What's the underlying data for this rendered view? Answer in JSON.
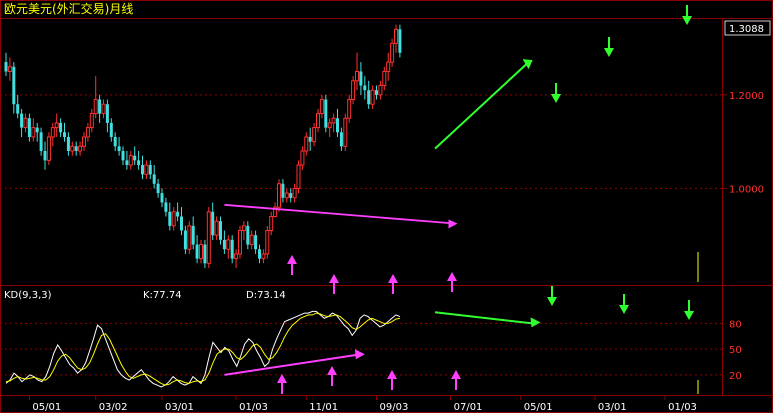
{
  "chart_data": [
    {
      "type": "candlestick",
      "title": "欧元美元(外汇交易)月线",
      "last_price_label": "1.3088",
      "y_ticks": [
        "1.2000",
        "1.0000"
      ],
      "y_tick_values": [
        1.2,
        1.0
      ],
      "ylim": [
        0.8,
        1.36
      ],
      "x_tick_labels": [
        "05/01",
        "03/02",
        "03/01",
        "01/03",
        "11/01",
        "09/03",
        "07/01",
        "05/01",
        "03/01",
        "01/03"
      ],
      "x_tick_index": [
        6,
        23,
        40,
        59,
        77,
        95,
        114,
        132,
        151,
        169
      ],
      "up_color": "#ff3030",
      "down_color": "#40e0e0",
      "candles": [
        [
          1.27,
          1.29,
          1.24,
          1.25
        ],
        [
          1.25,
          1.28,
          1.23,
          1.26
        ],
        [
          1.26,
          1.27,
          1.16,
          1.18
        ],
        [
          1.18,
          1.2,
          1.15,
          1.16
        ],
        [
          1.16,
          1.17,
          1.11,
          1.13
        ],
        [
          1.13,
          1.16,
          1.12,
          1.15
        ],
        [
          1.15,
          1.16,
          1.1,
          1.11
        ],
        [
          1.11,
          1.15,
          1.1,
          1.13
        ],
        [
          1.13,
          1.14,
          1.1,
          1.12
        ],
        [
          1.12,
          1.13,
          1.07,
          1.08
        ],
        [
          1.08,
          1.1,
          1.04,
          1.06
        ],
        [
          1.06,
          1.12,
          1.05,
          1.11
        ],
        [
          1.11,
          1.14,
          1.09,
          1.13
        ],
        [
          1.13,
          1.16,
          1.11,
          1.14
        ],
        [
          1.14,
          1.15,
          1.11,
          1.12
        ],
        [
          1.12,
          1.14,
          1.1,
          1.11
        ],
        [
          1.11,
          1.12,
          1.07,
          1.08
        ],
        [
          1.08,
          1.1,
          1.07,
          1.09
        ],
        [
          1.09,
          1.1,
          1.07,
          1.08
        ],
        [
          1.08,
          1.1,
          1.07,
          1.09
        ],
        [
          1.09,
          1.12,
          1.08,
          1.11
        ],
        [
          1.11,
          1.14,
          1.1,
          1.13
        ],
        [
          1.13,
          1.17,
          1.12,
          1.16
        ],
        [
          1.16,
          1.24,
          1.15,
          1.19
        ],
        [
          1.19,
          1.2,
          1.14,
          1.16
        ],
        [
          1.16,
          1.19,
          1.15,
          1.18
        ],
        [
          1.18,
          1.19,
          1.12,
          1.14
        ],
        [
          1.14,
          1.15,
          1.1,
          1.11
        ],
        [
          1.11,
          1.12,
          1.08,
          1.09
        ],
        [
          1.09,
          1.11,
          1.07,
          1.08
        ],
        [
          1.08,
          1.09,
          1.05,
          1.06
        ],
        [
          1.06,
          1.08,
          1.04,
          1.05
        ],
        [
          1.05,
          1.08,
          1.04,
          1.07
        ],
        [
          1.07,
          1.09,
          1.05,
          1.06
        ],
        [
          1.06,
          1.08,
          1.04,
          1.05
        ],
        [
          1.05,
          1.07,
          1.02,
          1.03
        ],
        [
          1.03,
          1.06,
          1.02,
          1.05
        ],
        [
          1.05,
          1.06,
          1.02,
          1.03
        ],
        [
          1.03,
          1.05,
          1.0,
          1.01
        ],
        [
          1.01,
          1.02,
          0.98,
          0.99
        ],
        [
          0.99,
          1.0,
          0.96,
          0.97
        ],
        [
          0.97,
          0.98,
          0.94,
          0.95
        ],
        [
          0.95,
          0.97,
          0.91,
          0.92
        ],
        [
          0.92,
          0.96,
          0.91,
          0.95
        ],
        [
          0.95,
          0.97,
          0.93,
          0.94
        ],
        [
          0.94,
          0.96,
          0.9,
          0.91
        ],
        [
          0.91,
          0.92,
          0.86,
          0.87
        ],
        [
          0.87,
          0.93,
          0.86,
          0.92
        ],
        [
          0.92,
          0.94,
          0.87,
          0.88
        ],
        [
          0.88,
          0.9,
          0.84,
          0.85
        ],
        [
          0.85,
          0.89,
          0.84,
          0.88
        ],
        [
          0.88,
          0.89,
          0.83,
          0.84
        ],
        [
          0.84,
          0.96,
          0.83,
          0.95
        ],
        [
          0.95,
          0.97,
          0.89,
          0.9
        ],
        [
          0.9,
          0.94,
          0.89,
          0.93
        ],
        [
          0.93,
          0.94,
          0.88,
          0.89
        ],
        [
          0.89,
          0.91,
          0.86,
          0.87
        ],
        [
          0.87,
          0.9,
          0.85,
          0.89
        ],
        [
          0.89,
          0.9,
          0.84,
          0.85
        ],
        [
          0.85,
          0.87,
          0.83,
          0.86
        ],
        [
          0.86,
          0.92,
          0.85,
          0.91
        ],
        [
          0.91,
          0.93,
          0.89,
          0.92
        ],
        [
          0.92,
          0.93,
          0.87,
          0.88
        ],
        [
          0.88,
          0.91,
          0.87,
          0.9
        ],
        [
          0.9,
          0.91,
          0.86,
          0.87
        ],
        [
          0.87,
          0.88,
          0.84,
          0.85
        ],
        [
          0.85,
          0.87,
          0.84,
          0.86
        ],
        [
          0.86,
          0.92,
          0.85,
          0.91
        ],
        [
          0.91,
          0.95,
          0.9,
          0.94
        ],
        [
          0.94,
          0.96,
          0.97,
          0.96
        ],
        [
          0.96,
          1.02,
          0.95,
          1.01
        ],
        [
          1.01,
          1.02,
          0.97,
          0.98
        ],
        [
          0.98,
          1.0,
          0.97,
          0.99
        ],
        [
          0.99,
          1.0,
          0.97,
          0.98
        ],
        [
          0.98,
          1.01,
          0.97,
          1.0
        ],
        [
          1.0,
          1.06,
          0.99,
          1.05
        ],
        [
          1.05,
          1.09,
          1.04,
          1.08
        ],
        [
          1.08,
          1.12,
          1.07,
          1.11
        ],
        [
          1.11,
          1.13,
          1.08,
          1.1
        ],
        [
          1.1,
          1.14,
          1.09,
          1.13
        ],
        [
          1.13,
          1.17,
          1.12,
          1.16
        ],
        [
          1.16,
          1.2,
          1.15,
          1.19
        ],
        [
          1.19,
          1.2,
          1.12,
          1.13
        ],
        [
          1.13,
          1.15,
          1.11,
          1.14
        ],
        [
          1.14,
          1.16,
          1.12,
          1.15
        ],
        [
          1.15,
          1.17,
          1.11,
          1.12
        ],
        [
          1.12,
          1.13,
          1.08,
          1.09
        ],
        [
          1.09,
          1.16,
          1.08,
          1.15
        ],
        [
          1.15,
          1.2,
          1.14,
          1.19
        ],
        [
          1.19,
          1.24,
          1.18,
          1.23
        ],
        [
          1.23,
          1.29,
          1.21,
          1.25
        ],
        [
          1.25,
          1.27,
          1.2,
          1.22
        ],
        [
          1.22,
          1.24,
          1.19,
          1.21
        ],
        [
          1.21,
          1.23,
          1.17,
          1.18
        ],
        [
          1.18,
          1.22,
          1.17,
          1.21
        ],
        [
          1.21,
          1.22,
          1.19,
          1.2
        ],
        [
          1.2,
          1.23,
          1.19,
          1.22
        ],
        [
          1.22,
          1.26,
          1.21,
          1.25
        ],
        [
          1.25,
          1.29,
          1.23,
          1.27
        ],
        [
          1.27,
          1.32,
          1.26,
          1.31
        ],
        [
          1.31,
          1.35,
          1.29,
          1.34
        ],
        [
          1.34,
          1.35,
          1.28,
          1.29
        ]
      ],
      "annotations": {
        "magenta_trendline": [
          [
            56,
            0.965
          ],
          [
            115,
            0.925
          ]
        ],
        "green_trendline": [
          [
            110,
            1.085
          ],
          [
            134,
            1.27
          ]
        ]
      }
    },
    {
      "type": "line",
      "title": "KD(9,3,3)",
      "legend": [
        {
          "name": "K",
          "label": "K:77.74"
        },
        {
          "name": "D",
          "label": "D:73.14"
        }
      ],
      "y_ticks": [
        "80",
        "50",
        "20"
      ],
      "y_tick_values": [
        80,
        50,
        20
      ],
      "ylim": [
        0,
        105
      ],
      "series": [
        {
          "name": "K",
          "color": "#ffffff",
          "values": [
            10,
            14,
            22,
            18,
            12,
            16,
            20,
            18,
            14,
            12,
            18,
            30,
            45,
            55,
            48,
            40,
            32,
            28,
            22,
            26,
            34,
            48,
            62,
            78,
            74,
            62,
            50,
            38,
            26,
            20,
            16,
            14,
            18,
            22,
            26,
            20,
            14,
            10,
            8,
            6,
            8,
            12,
            18,
            14,
            10,
            8,
            10,
            18,
            14,
            10,
            20,
            40,
            58,
            52,
            46,
            52,
            48,
            38,
            30,
            42,
            56,
            62,
            58,
            48,
            40,
            30,
            34,
            50,
            62,
            72,
            82,
            84,
            86,
            88,
            90,
            92,
            92,
            94,
            94,
            90,
            86,
            88,
            92,
            90,
            84,
            78,
            74,
            66,
            72,
            86,
            90,
            88,
            84,
            80,
            76,
            78,
            82,
            86,
            90,
            88
          ]
        },
        {
          "name": "D",
          "color": "#ffff00",
          "values": [
            12,
            13,
            16,
            18,
            16,
            15,
            16,
            17,
            16,
            14,
            14,
            18,
            26,
            36,
            42,
            44,
            40,
            34,
            28,
            26,
            28,
            34,
            44,
            56,
            66,
            68,
            62,
            52,
            42,
            32,
            24,
            18,
            16,
            18,
            20,
            21,
            19,
            16,
            13,
            10,
            8,
            9,
            12,
            14,
            13,
            11,
            10,
            12,
            13,
            12,
            14,
            22,
            34,
            44,
            48,
            50,
            50,
            46,
            40,
            38,
            42,
            48,
            54,
            56,
            52,
            44,
            38,
            40,
            46,
            54,
            64,
            72,
            78,
            82,
            86,
            88,
            90,
            90,
            92,
            91,
            89,
            88,
            89,
            90,
            88,
            84,
            80,
            75,
            73,
            76,
            80,
            84,
            86,
            84,
            82,
            80,
            80,
            82,
            85,
            86
          ]
        }
      ],
      "annotations": {
        "magenta_trendline": [
          [
            56,
            20
          ],
          [
            91,
            44
          ]
        ],
        "green_trendline": [
          [
            110,
            93
          ],
          [
            135,
            80
          ]
        ]
      }
    }
  ]
}
